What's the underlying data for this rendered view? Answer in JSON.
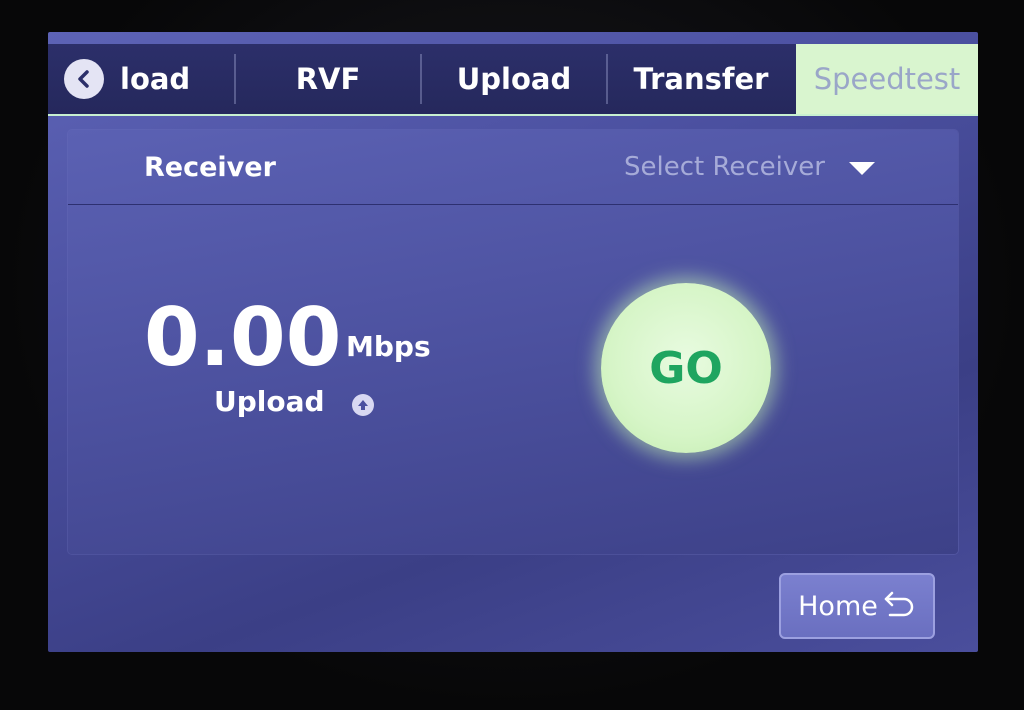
{
  "tabs": {
    "back_label": "load",
    "items": [
      {
        "label": "RVF"
      },
      {
        "label": "Upload"
      },
      {
        "label": "Transfer"
      },
      {
        "label": "Speedtest",
        "active": true
      }
    ],
    "active_color": "#d9f5cf"
  },
  "panel": {
    "receiver_label": "Receiver",
    "receiver_select": {
      "selected": "Select Receiver",
      "icon": "caret-down-icon"
    },
    "speed": {
      "value": "0.00",
      "unit": "Mbps",
      "direction_label": "Upload",
      "direction_icon": "upload-arrow-icon"
    },
    "go_label": "GO",
    "go_color": "#1fa560"
  },
  "footer": {
    "home_label": "Home",
    "home_icon": "return-arrow-icon"
  }
}
